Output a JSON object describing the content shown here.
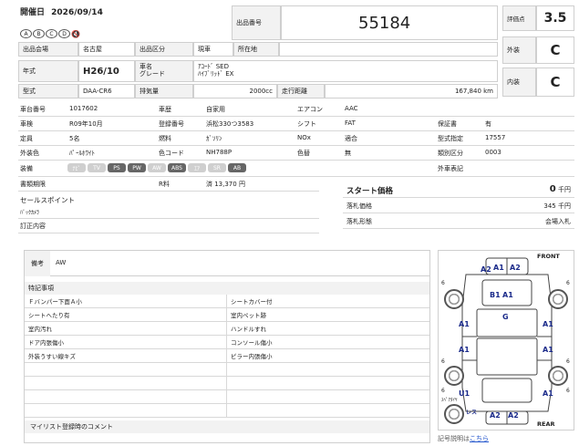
{
  "header": {
    "date_label": "開催日",
    "date_value": "2026/09/14",
    "badges": [
      "A",
      "B",
      "C",
      "D"
    ],
    "lot_label": "出品番号",
    "lot_value": "55184",
    "score_label": "評価点",
    "score_value": "3.5",
    "exterior_label": "外装",
    "exterior_value": "C",
    "interior_label": "内装",
    "interior_value": "C",
    "venue_label": "出品会場",
    "venue_value": "名古屋",
    "category_label": "出品区分",
    "category_value": "現車",
    "location_label": "所在地",
    "location_value": ""
  },
  "vehicle": {
    "year_label": "年式",
    "year_value": "H26/10",
    "name_label": "車名",
    "grade_label": "グレード",
    "name_value": "ｱｺｰﾄﾞ SED",
    "grade_value": "ﾊｲﾌﾞﾘｯﾄﾞ EX",
    "model_label": "型式",
    "model_value": "DAA-CR6",
    "displacement_label": "排気量",
    "displacement_value": "2000cc",
    "mileage_label": "走行距離",
    "mileage_value": "167,840 km"
  },
  "specs": {
    "chassis_label": "車台番号",
    "chassis_value": "1017602",
    "history_label": "車歴",
    "history_value": "自家用",
    "ac_label": "エアコン",
    "ac_value": "AAC",
    "inspection_label": "車検",
    "inspection_value": "R09年10月",
    "plate_label": "登録番号",
    "plate_value": "浜松330つ3583",
    "shift_label": "シフト",
    "shift_value": "FAT",
    "warranty_label": "保証書",
    "warranty_value": "有",
    "capacity_label": "定員",
    "capacity_value": "5名",
    "fuel_label": "燃料",
    "fuel_value": "ｶﾞｿﾘﾝ",
    "nox_label": "NOx",
    "nox_value": "適合",
    "typecert_label": "型式指定",
    "typecert_value": "17557",
    "color_label": "外装色",
    "color_value": "ﾊﾟｰﾙﾎﾜｲﾄ",
    "colorcode_label": "色コード",
    "colorcode_value": "NH788P",
    "colorchange_label": "色替",
    "colorchange_value": "無",
    "class_label": "類別区分",
    "class_value": "0003",
    "equip_label": "装備",
    "equipment": [
      {
        "name": "ﾅﾋﾞ",
        "on": false
      },
      {
        "name": "TV",
        "on": false
      },
      {
        "name": "PS",
        "on": true
      },
      {
        "name": "PW",
        "on": true
      },
      {
        "name": "AW",
        "on": false
      },
      {
        "name": "ABS",
        "on": true
      },
      {
        "name": "ｴｱ",
        "on": false
      },
      {
        "name": "SR",
        "on": false
      },
      {
        "name": "AB",
        "on": true
      }
    ],
    "foreign_label": "外車表記",
    "foreign_value": "",
    "doc_label": "書類期限",
    "doc_value": "",
    "recycle_label": "R料",
    "recycle_value": "済 13,370 円",
    "selling_label": "セールスポイント",
    "selling_value": "ﾊﾞｯｸｶﾒﾗ",
    "correction_label": "訂正内容"
  },
  "prices": {
    "start_label": "スタート価格",
    "start_value": "0",
    "start_unit": "千円",
    "sold_label": "落札価格",
    "sold_value": "345",
    "sold_unit": "千円",
    "form_label": "落札形態",
    "form_value": "会場入札"
  },
  "remarks": {
    "note_label": "備考",
    "note_value": "AW",
    "special_label": "特記事項",
    "left": [
      "Ｆバンパー下面Ａ小",
      "シートへたり有",
      "室内汚れ",
      "ドア内張傷小",
      "外装うすい線キズ",
      "",
      "",
      "",
      ""
    ],
    "right": [
      "シートカバー付",
      "室内ペット跡",
      "ハンドルすれ",
      "コンソール傷小",
      "ピラー内張傷小",
      "",
      "",
      "",
      ""
    ],
    "mylist_label": "マイリスト登録時のコメント"
  },
  "diagram": {
    "front": "FRONT",
    "rear": "REAR",
    "codes": [
      "A2",
      "A1",
      "A2",
      "B1",
      "A1",
      "G",
      "A1",
      "A1",
      "A1",
      "A1",
      "U1",
      "A1",
      "A2",
      "A2"
    ],
    "tire_marks": [
      "6",
      "6",
      "6",
      "6",
      "6",
      "6"
    ],
    "spare_label": "ｽﾍﾟｱﾀｲﾔ",
    "less_label": "レス",
    "legend_text": "記号説明は",
    "legend_link": "こちら"
  },
  "colors": {
    "label_bg": "#f2f2f2",
    "border": "#cfcfcf",
    "diagram_text": "#1a2a8a",
    "link": "#2255cc"
  }
}
